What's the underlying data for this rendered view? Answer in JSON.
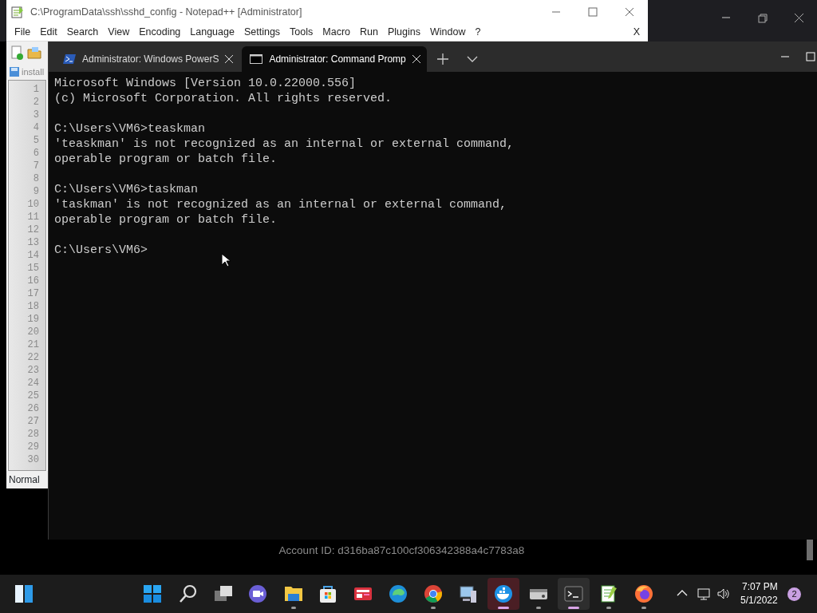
{
  "notepad": {
    "title": "C:\\ProgramData\\ssh\\sshd_config - Notepad++ [Administrator]",
    "menu": [
      "File",
      "Edit",
      "Search",
      "View",
      "Encoding",
      "Language",
      "Settings",
      "Tools",
      "Macro",
      "Run",
      "Plugins",
      "Window",
      "?"
    ],
    "close_document": "X",
    "tab": "install",
    "line_numbers": [
      "1",
      "2",
      "3",
      "4",
      "5",
      "6",
      "7",
      "8",
      "9",
      "10",
      "11",
      "12",
      "13",
      "14",
      "15",
      "16",
      "17",
      "18",
      "19",
      "20",
      "21",
      "22",
      "23",
      "24",
      "25",
      "26",
      "27",
      "28",
      "29",
      "30"
    ],
    "status": "Normal"
  },
  "terminal": {
    "tabs": [
      {
        "title": "Administrator: Windows PowerS",
        "selected": false
      },
      {
        "title": "Administrator: Command Promp",
        "selected": true
      }
    ],
    "blocks": [
      [
        "Microsoft Windows [Version 10.0.22000.556]",
        "(c) Microsoft Corporation. All rights reserved."
      ],
      [
        "C:\\Users\\VM6>teaskman",
        "'teaskman' is not recognized as an internal or external command,",
        "operable program or batch file."
      ],
      [
        "C:\\Users\\VM6>taskman",
        "'taskman' is not recognized as an internal or external command,",
        "operable program or batch file."
      ],
      [
        "C:\\Users\\VM6>"
      ]
    ]
  },
  "desktop_text": "Account ID: d316ba87c100cf306342388a4c7783a8",
  "taskbar": {
    "apps": [
      {
        "running": false,
        "selected": false,
        "attention": false
      },
      {
        "running": false,
        "selected": false,
        "attention": false
      },
      {
        "running": false,
        "selected": false,
        "attention": false
      },
      {
        "running": false,
        "selected": false,
        "attention": false
      },
      {
        "running": true,
        "selected": false,
        "attention": false
      },
      {
        "running": false,
        "selected": false,
        "attention": false
      },
      {
        "running": false,
        "selected": false,
        "attention": false
      },
      {
        "running": false,
        "selected": false,
        "attention": false
      },
      {
        "running": true,
        "selected": false,
        "attention": false
      },
      {
        "running": false,
        "selected": false,
        "attention": false
      },
      {
        "running": true,
        "selected": false,
        "attention": true
      },
      {
        "running": true,
        "selected": false,
        "attention": false
      },
      {
        "running": true,
        "selected": true,
        "attention": false
      },
      {
        "running": true,
        "selected": false,
        "attention": false
      },
      {
        "running": true,
        "selected": false,
        "attention": false
      }
    ],
    "time": "7:07 PM",
    "date": "5/1/2022",
    "notification_count": "2"
  }
}
